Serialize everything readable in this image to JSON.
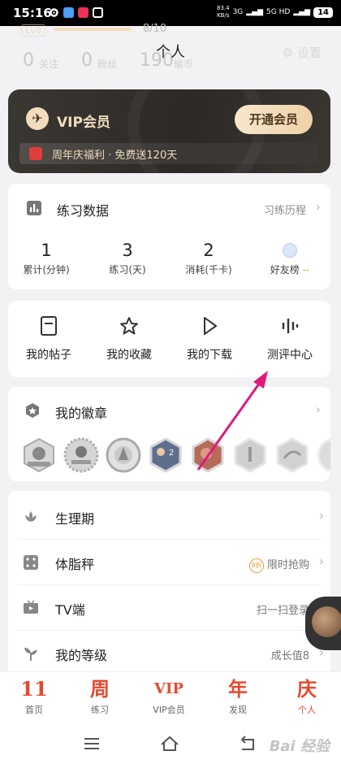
{
  "status_bar": {
    "time": "15:16",
    "net_speed": "83.4",
    "net_unit": "KB/s",
    "signal": "3G",
    "signal2": "5G HD",
    "battery": "14"
  },
  "profile": {
    "level_badge": "Lv0",
    "level_progress": "8/10",
    "level_progress_fraction": 0.8,
    "page_title": "个人",
    "stats": [
      {
        "value": "0",
        "label": "关注"
      },
      {
        "value": "0",
        "label": "粉丝"
      },
      {
        "value": "190",
        "label": "瑜币"
      }
    ],
    "settings_label": "设置"
  },
  "vip": {
    "logo": "✈",
    "title": "VIP会员",
    "button": "开通会员",
    "promo": "周年庆福利 · 免费送120天"
  },
  "practice": {
    "title": "练习数据",
    "link": "习练历程",
    "stats": [
      {
        "value": "1",
        "label": "累计(分钟)"
      },
      {
        "value": "3",
        "label": "练习(天)"
      },
      {
        "value": "2",
        "label": "消耗(千卡)"
      }
    ],
    "friends_label": "好友榜",
    "friends_value": "--"
  },
  "shortcuts": [
    {
      "label": "我的帖子",
      "icon": "post-icon"
    },
    {
      "label": "我的收藏",
      "icon": "star-icon"
    },
    {
      "label": "我的下载",
      "icon": "play-icon"
    },
    {
      "label": "测评中心",
      "icon": "equalizer-icon"
    }
  ],
  "badges": {
    "title": "我的徽章",
    "items": [
      "badge-1",
      "badge-2",
      "badge-3",
      "badge-4",
      "badge-5",
      "badge-6",
      "badge-7",
      "badge-8",
      "badge-9"
    ]
  },
  "menu": [
    {
      "label": "生理期",
      "right": "",
      "icon": "lotus-icon"
    },
    {
      "label": "体脂秤",
      "right": "限时抢购",
      "tag": "8折",
      "icon": "scale-icon"
    },
    {
      "label": "TV端",
      "right": "扫一扫登录",
      "icon": "tv-icon"
    },
    {
      "label": "我的等级",
      "right": "成长值8",
      "icon": "sprout-icon"
    }
  ],
  "tabs": [
    {
      "glyph": "11",
      "label": "首页"
    },
    {
      "glyph": "周",
      "label": "练习"
    },
    {
      "glyph": "VIP",
      "label": "VIP会员"
    },
    {
      "glyph": "年",
      "label": "发现"
    },
    {
      "glyph": "庆",
      "label": "个人"
    }
  ],
  "watermark": "Bai 经验",
  "colors": {
    "accent": "#e6492f",
    "vip_gold": "#f1dbbd",
    "annotation_arrow": "#e0197d"
  }
}
